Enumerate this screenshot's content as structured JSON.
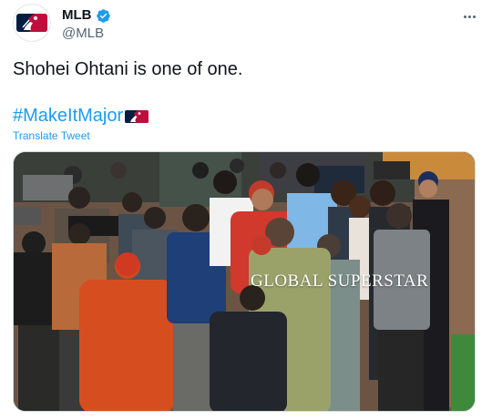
{
  "author": {
    "display_name": "MLB",
    "handle": "@MLB",
    "avatar_icon": "mlb-logo-icon",
    "verified_icon": "verified-badge-icon",
    "verified_color": "#1d9bf0"
  },
  "menu": {
    "icon": "more-horizontal-icon"
  },
  "tweet": {
    "text": "Shohei Ohtani is one of one.",
    "hashtag": "#MakeItMajor",
    "hashtag_flair_icon": "mlb-hashflair-icon",
    "translate_label": "Translate Tweet"
  },
  "media": {
    "overlay_text": "GLOBAL SUPERSTAR"
  },
  "colors": {
    "link": "#1d9bf0",
    "text": "#0f1419",
    "secondary": "#536471",
    "mlb_blue": "#041e42",
    "mlb_red": "#bf0d3e"
  }
}
